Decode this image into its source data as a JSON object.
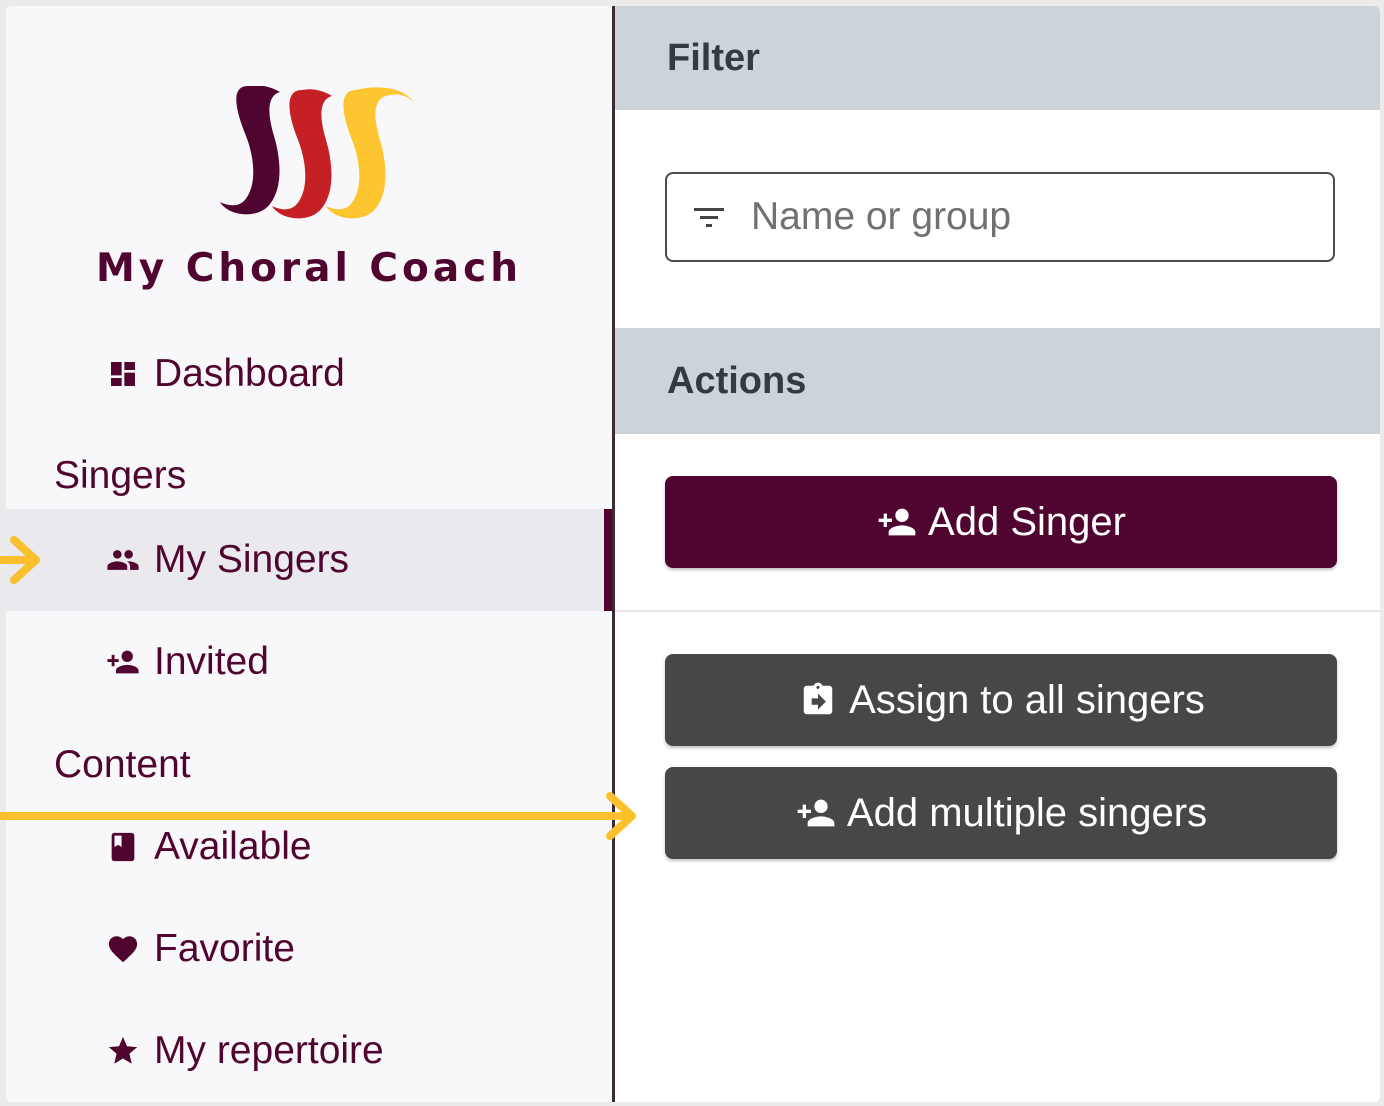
{
  "brand": {
    "name": "My Choral Coach"
  },
  "sidebar": {
    "dashboard": {
      "label": "Dashboard",
      "icon": "dashboard-icon"
    },
    "sections": [
      {
        "title": "Singers"
      },
      {
        "title": "Content"
      }
    ],
    "singers_items": [
      {
        "label": "My Singers",
        "icon": "group-icon",
        "active": true
      },
      {
        "label": "Invited",
        "icon": "person-add-icon"
      }
    ],
    "content_items": [
      {
        "label": "Available",
        "icon": "book-icon"
      },
      {
        "label": "Favorite",
        "icon": "heart-icon"
      },
      {
        "label": "My repertoire",
        "icon": "star-icon"
      }
    ]
  },
  "filter": {
    "title": "Filter",
    "placeholder": "Name or group",
    "value": ""
  },
  "actions": {
    "title": "Actions",
    "add_singer": "Add Singer",
    "assign_all": "Assign to all singers",
    "add_multiple": "Add multiple singers"
  },
  "colors": {
    "brand": "#500530",
    "accent_red": "#c62027",
    "accent_yellow": "#fdc52f",
    "header_gray": "#ccd4da",
    "button_dark": "#474747",
    "annotation": "#fbc02d"
  }
}
